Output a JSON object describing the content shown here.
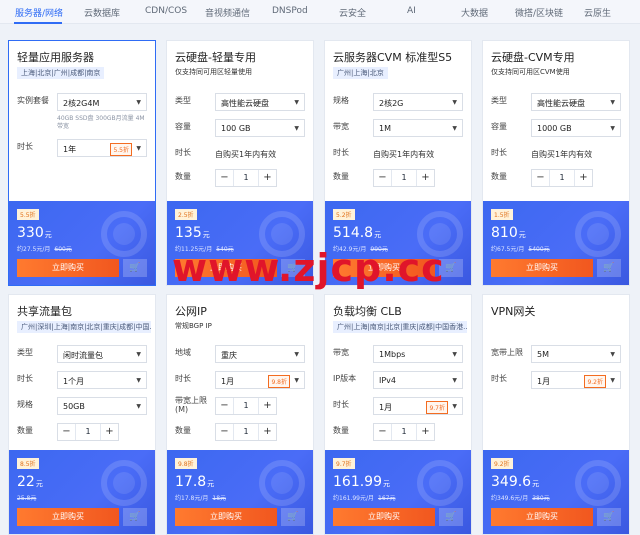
{
  "tabs": [
    {
      "label": "服务器/网络"
    },
    {
      "label": "云数据库"
    },
    {
      "label": "CDN/COS"
    },
    {
      "label": "音视频通信"
    },
    {
      "label": "DNSPod"
    },
    {
      "label": "云安全"
    },
    {
      "label": "AI"
    },
    {
      "label": "大数据"
    },
    {
      "label": "微搭/区块链"
    },
    {
      "label": "云原生"
    }
  ],
  "cards": [
    {
      "title": "轻量应用服务器",
      "subtitle": "上海|北京|广州|成都|南京",
      "rows": [
        {
          "label": "实例套餐",
          "value": "2核2G4M"
        },
        {
          "note": "40GB SSD盘 300GB月流量 4M带宽"
        },
        {
          "label": "时长",
          "value": "1年",
          "discount": "5.5折"
        },
        {
          "label": "数量",
          "qty": "1"
        }
      ],
      "badge": "5.5折",
      "price": "330",
      "unit": "元",
      "per": "约27.5元/月",
      "old": "600元",
      "buy": "立即购买",
      "cart": "cart"
    },
    {
      "title": "云硬盘-轻量专用",
      "subtitle": "仅支持同可用区轻量使用",
      "rows": [
        {
          "label": "类型",
          "value": "高性能云硬盘"
        },
        {
          "label": "容量",
          "value": "100 GB"
        },
        {
          "label": "时长",
          "text": "自购买1年内有效"
        },
        {
          "label": "数量",
          "qty": "1"
        }
      ],
      "badge": "2.5折",
      "price": "135",
      "unit": "元",
      "per": "约11.25元/月",
      "old": "540元",
      "buy": "立即购买",
      "cart": "cart"
    },
    {
      "title": "云服务器CVM 标准型S5",
      "subtitle": "广州|上海|北京",
      "rows": [
        {
          "label": "规格",
          "value": "2核2G"
        },
        {
          "label": "带宽",
          "value": "1M"
        },
        {
          "label": "时长",
          "text": "自购买1年内有效"
        },
        {
          "label": "数量",
          "qty": "1"
        }
      ],
      "badge": "5.2折",
      "price": "514.8",
      "unit": "元",
      "per": "约42.9元/月",
      "old": "990元",
      "buy": "立即购买",
      "cart": "cart"
    },
    {
      "title": "云硬盘-CVM专用",
      "subtitle": "仅支持同可用区CVM使用",
      "rows": [
        {
          "label": "类型",
          "value": "高性能云硬盘"
        },
        {
          "label": "容量",
          "value": "1000 GB"
        },
        {
          "label": "时长",
          "text": "自购买1年内有效"
        },
        {
          "label": "数量",
          "qty": "1"
        }
      ],
      "badge": "1.5折",
      "price": "810",
      "unit": "元",
      "per": "约67.5元/月",
      "old": "5400元",
      "buy": "立即购买",
      "cart": "cart"
    },
    {
      "title": "共享流量包",
      "subtitle": "广州|深圳|上海|南京|北京|重庆|成都|中国...",
      "rows": [
        {
          "label": "类型",
          "value": "闲时流量包"
        },
        {
          "label": "时长",
          "value": "1个月"
        },
        {
          "label": "规格",
          "value": "50GB"
        },
        {
          "label": "数量",
          "qty": "1"
        }
      ],
      "badge": "8.5折",
      "price": "22",
      "unit": "元",
      "per": "25.8元",
      "old": "",
      "buy": "立即购买",
      "cart": "cart"
    },
    {
      "title": "公网IP",
      "subtitle": "常规BGP IP",
      "rows": [
        {
          "label": "地域",
          "value": "重庆"
        },
        {
          "label": "时长",
          "value": "1月",
          "discount": "9.8折"
        },
        {
          "label": "带宽上限(M)",
          "qty": "1"
        },
        {
          "label": "数量",
          "qty": "1"
        }
      ],
      "badge": "9.8折",
      "price": "17.8",
      "unit": "元",
      "per": "约17.8元/月",
      "old": "18元",
      "buy": "立即购买",
      "cart": "cart"
    },
    {
      "title": "负载均衡 CLB",
      "subtitle": "广州|上海|南京|北京|重庆|成都|中国香港...",
      "rows": [
        {
          "label": "带宽",
          "value": "1Mbps"
        },
        {
          "label": "IP版本",
          "value": "IPv4"
        },
        {
          "label": "时长",
          "value": "1月",
          "discount": "9.7折"
        },
        {
          "label": "数量",
          "qty": "1"
        }
      ],
      "badge": "9.7折",
      "price": "161.99",
      "unit": "元",
      "per": "约161.99元/月",
      "old": "167元",
      "buy": "立即购买",
      "cart": "cart"
    },
    {
      "title": "VPN网关",
      "subtitle": "",
      "rows": [
        {
          "label": "宽带上限",
          "value": "5M"
        },
        {
          "label": "时长",
          "value": "1月",
          "discount": "9.2折"
        }
      ],
      "badge": "9.2折",
      "price": "349.6",
      "unit": "元",
      "per": "约349.6元/月",
      "old": "380元",
      "buy": "立即购买",
      "cart": "cart"
    }
  ],
  "watermark": "www.zjcp.cc"
}
